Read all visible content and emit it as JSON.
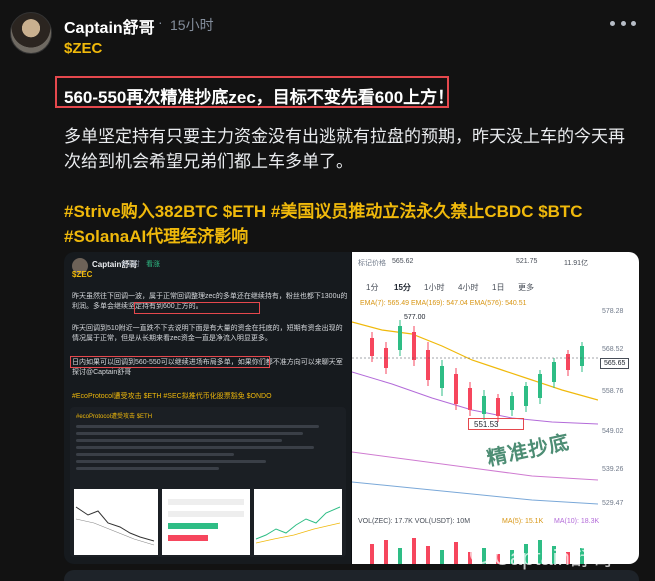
{
  "post": {
    "author": "Captain舒哥",
    "separator": "·",
    "time": "15小时",
    "coin_tag": "$ZEC",
    "headline": "560-550再次精准抄底zec，目标不变先看600上方！",
    "body": "多单坚定持有只要主力资金没有出逃就有拉盘的预期，昨天没上车的今天再次给到机会希望兄弟们都上车多单了。",
    "hashtags": "#Strive购入382BTC $ETH #美国议员推动立法永久禁止CBDC $BTC #SolanaAI代理经济影响",
    "watermark": "Captain舒哥",
    "more_icon": "more-horizontal-icon"
  },
  "inner_post": {
    "author": "Captain舒哥",
    "time": "8小时",
    "sentiment": "看涨",
    "coin_tag": "$ZEC",
    "p1": "昨天虽然往下回调一波，属于正常回调整理zec的多单还在继续持有，粉丝也都下1300u的利润。多单会继续坚定持有到600上方的。",
    "p2": "昨天回调到510附近一直跌不下去说明下面是有大量的资金在托底的，短期有资金出现的情况属于正常，但是从长期来看zec资金一直是净流入明显更多。",
    "p3": "日内如果可以回调到560-550可以继续进场布局多单，如果你们都不准方向可以来聊天室探讨@Captain舒哥",
    "hashtags": "#EcoProtocol遭受攻击 $ETH #SEC拟推代币化股票豁免 $ONDO",
    "nested_title": "#ecoProtocol遭受攻击 $ETH"
  },
  "chart": {
    "mark_price_label": "标记价格",
    "mark_price": "565.62",
    "stat_mid": "521.75",
    "stat_right": "11.91亿",
    "timeframe_1": "1分",
    "timeframe_2": "15分",
    "timeframe_3": "1小时",
    "timeframe_4": "4小时",
    "timeframe_5": "1日",
    "timeframe_more": "更多",
    "ma_line": "EMA(7): 565.49  EMA(169): 547.04  EMA(576): 540.51",
    "high": "577.00",
    "low": "551.53",
    "current": "565.65",
    "axis": [
      "578.28",
      "568.52",
      "558.76",
      "549.02",
      "539.26",
      "529.47"
    ],
    "volume_line": "VOL(ZEC): 17.7K  VOL(USDT): 10M",
    "ma5": "MA(5): 15.1K",
    "ma10": "MA(10): 18.3K",
    "stamp": "精准抄底"
  }
}
